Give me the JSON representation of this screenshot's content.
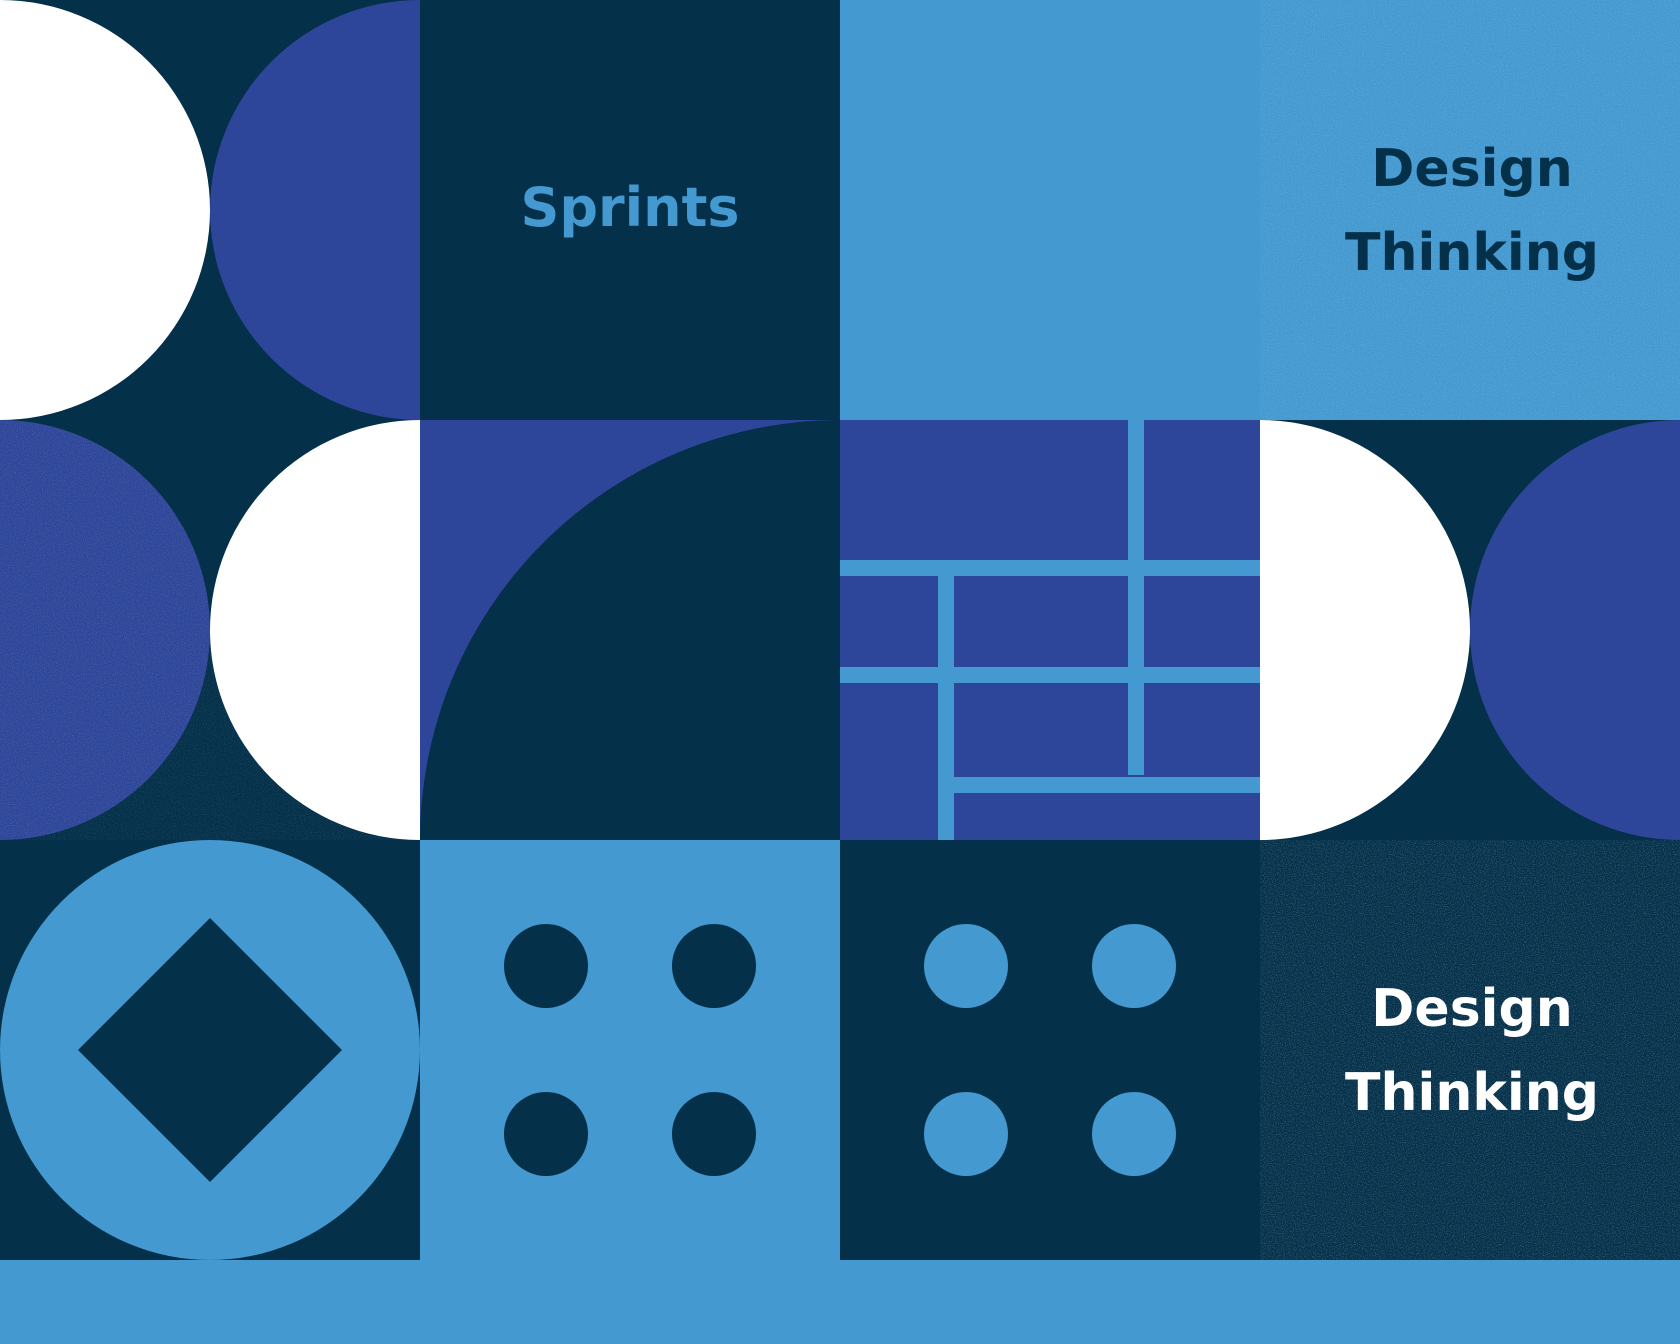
{
  "palette": {
    "navy": "#04304a",
    "indigo": "#2e4699",
    "sky": "#4399d0",
    "white": "#ffffff"
  },
  "labels": {
    "sprints": "Sprints",
    "design_thinking_top": {
      "line1": "Design",
      "line2": "Thinking"
    },
    "design_thinking_bottom": {
      "line1": "Design",
      "line2": "Thinking"
    }
  },
  "shapes": {
    "dot_grid_rows": 2,
    "dot_grid_cols": 2
  }
}
